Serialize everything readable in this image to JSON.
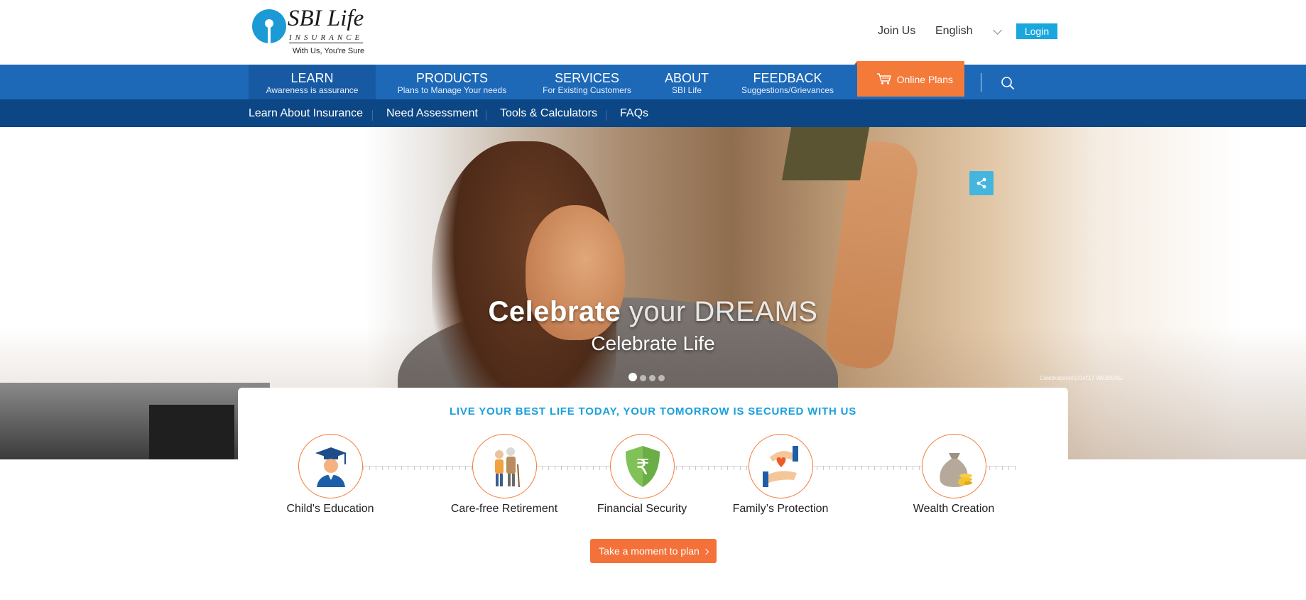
{
  "header": {
    "logo": {
      "brand": "SBI Life",
      "sub": "INSURANCE",
      "tagline": "With Us, You're Sure"
    },
    "join_label": "Join Us",
    "language": "English",
    "login_label": "Login"
  },
  "nav": {
    "items": [
      {
        "title": "LEARN",
        "subtitle": "Awareness is assurance"
      },
      {
        "title": "PRODUCTS",
        "subtitle": "Plans to Manage Your needs"
      },
      {
        "title": "SERVICES",
        "subtitle": "For Existing Customers"
      },
      {
        "title": "ABOUT",
        "subtitle": "SBI Life"
      },
      {
        "title": "FEEDBACK",
        "subtitle": "Suggestions/Grievances"
      }
    ],
    "online_plans": "Online Plans",
    "icons": {
      "cart": "cart-icon",
      "search": "search-icon"
    }
  },
  "subnav": {
    "items": [
      "Learn About Insurance",
      "Need Assessment",
      "Tools & Calculators",
      "FAQs"
    ]
  },
  "hero": {
    "line1_bold": "Celebrate",
    "line1_rest": " your DREAMS",
    "line2": "Celebrate Life",
    "credit": "Celebration/01/Oct'17 WEB/ENG",
    "slides": 4,
    "active_slide": 1
  },
  "card": {
    "title": "LIVE YOUR BEST LIFE TODAY, YOUR TOMORROW IS SECURED WITH US",
    "goals": [
      {
        "label": "Child's Education",
        "icon": "graduate-icon"
      },
      {
        "label": "Care-free Retirement",
        "icon": "elderly-couple-icon"
      },
      {
        "label": "Financial Security",
        "icon": "rupee-shield-icon"
      },
      {
        "label": "Family’s Protection",
        "icon": "hands-heart-icon"
      },
      {
        "label": "Wealth Creation",
        "icon": "money-bag-icon"
      }
    ],
    "cta": "Take a moment to plan"
  },
  "colors": {
    "nav_blue": "#1d69b8",
    "subnav_blue": "#0c4685",
    "accent_orange": "#f47a3a",
    "accent_cyan": "#1aa7de"
  }
}
